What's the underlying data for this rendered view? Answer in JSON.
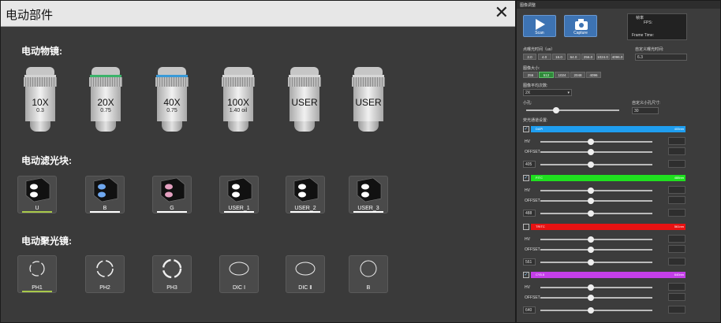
{
  "left": {
    "title": "电动部件",
    "objectives_label": "电动物镜:",
    "filters_label": "电动滤光块:",
    "condensers_label": "电动聚光镜:",
    "objectives": [
      {
        "mag": "10X",
        "na": "0.3",
        "ring": "#d4d4d4"
      },
      {
        "mag": "20X",
        "na": "0.75",
        "ring": "#3cb36a"
      },
      {
        "mag": "40X",
        "na": "0.75",
        "ring": "#3a9ad8"
      },
      {
        "mag": "100X",
        "na": "1.40 oil",
        "ring": "#d8d8d8"
      },
      {
        "mag": "USER",
        "na": "",
        "ring": "#d8d8d8"
      },
      {
        "mag": "USER",
        "na": "",
        "ring": "#d8d8d8"
      }
    ],
    "filters": [
      {
        "label": "U",
        "color": "#ffffff",
        "bar": "#a8c94a"
      },
      {
        "label": "B",
        "color": "#6fa8f0",
        "bar": "#ffffff"
      },
      {
        "label": "G",
        "color": "#e4a0c0",
        "bar": "#ffffff"
      },
      {
        "label": "USER_1",
        "color": "#ffffff",
        "bar": "#ffffff"
      },
      {
        "label": "USER_2",
        "color": "#ffffff",
        "bar": "#ffffff"
      },
      {
        "label": "USER_3",
        "color": "#ffffff",
        "bar": "#ffffff"
      }
    ],
    "condensers": [
      {
        "label": "PH1",
        "bar": "#a8c94a"
      },
      {
        "label": "PH2",
        "bar": ""
      },
      {
        "label": "PH3",
        "bar": ""
      },
      {
        "label": "DIC Ⅰ",
        "bar": ""
      },
      {
        "label": "DIC Ⅱ",
        "bar": ""
      },
      {
        "label": "B",
        "bar": ""
      }
    ]
  },
  "right": {
    "title": "图像调整",
    "scan_label": "Scan",
    "capture_label": "Capture",
    "fps_header": "帧率",
    "fps_label": "FPS:",
    "frame_time_label": "Frame Time:",
    "pixel_dwell_label": "点曝光时间（us）",
    "pixel_dwell_options": [
      "2.0",
      "4.0",
      "16.0",
      "64.0",
      "256.0",
      "1024.0",
      "4096.0"
    ],
    "custom_dwell_label": "自定义曝光时间:",
    "custom_dwell_value": "6.3",
    "image_size_label": "图像大小:",
    "image_size_options": [
      "256",
      "512",
      "1024",
      "2048",
      "4096"
    ],
    "image_size_selected": "512",
    "averaging_label": "图像平均次数:",
    "averaging_value": "2X",
    "pinhole_label": "小孔:",
    "custom_pinhole_label": "自定义小孔尺寸:",
    "custom_pinhole_value": "30",
    "channel_settings_label": "荧光通道设置:",
    "hv_label": "HV",
    "offset_label": "OFFSET",
    "channels": [
      {
        "name": "DAPI",
        "wavelength": "405nm",
        "color": "#1f9ef0",
        "laser": "405",
        "checked": "✓",
        "hv": 0.45,
        "offset": 0.45,
        "power": 0.45
      },
      {
        "name": "FITC",
        "wavelength": "488nm",
        "color": "#1fe01f",
        "laser": "488",
        "checked": "✓",
        "hv": 0.45,
        "offset": 0.45,
        "power": 0.45
      },
      {
        "name": "TRITC",
        "wavelength": "561nm",
        "color": "#e81212",
        "laser": "561",
        "checked": "",
        "hv": 0.45,
        "offset": 0.45,
        "power": 0.45
      },
      {
        "name": "CY5.5",
        "wavelength": "640nm",
        "color": "#c43fe8",
        "laser": "640",
        "checked": "✓",
        "hv": 0.45,
        "offset": 0.45,
        "power": 0.45
      }
    ]
  }
}
